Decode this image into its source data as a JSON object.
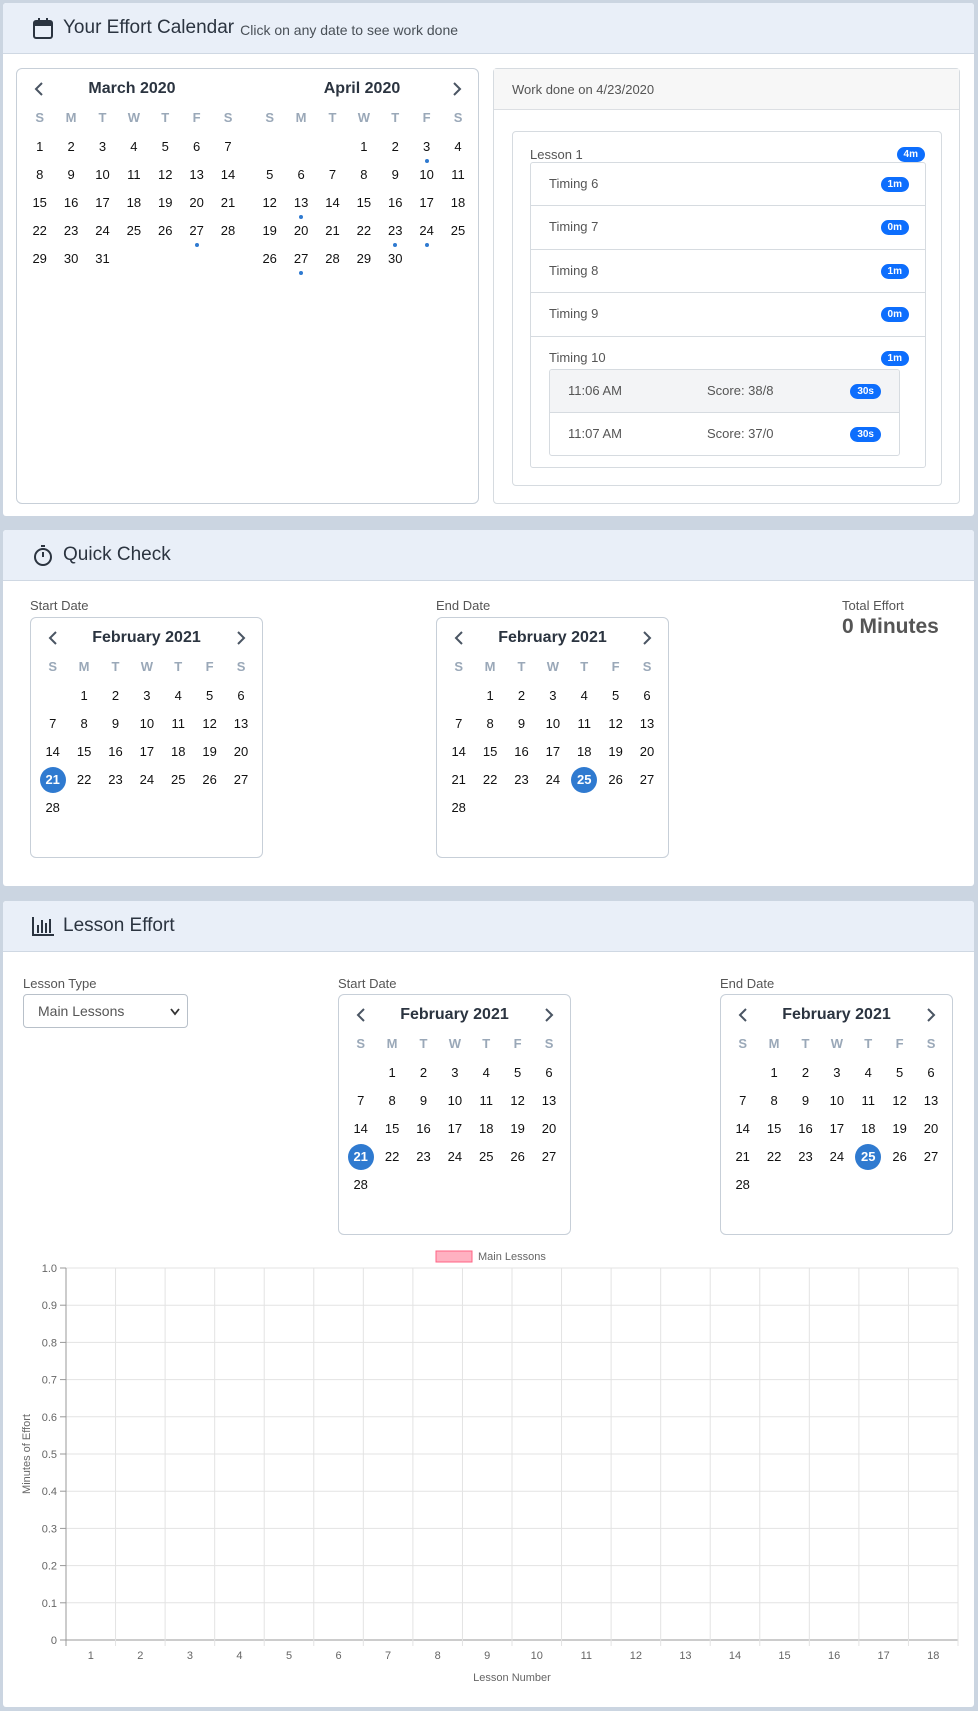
{
  "effort": {
    "title": "Your Effort Calendar",
    "subtitle": "Click on any date to see work done",
    "months": [
      {
        "title": "March 2020",
        "lead": 0,
        "days": 31,
        "dots": [
          27
        ]
      },
      {
        "title": "April 2020",
        "lead": 3,
        "days": 30,
        "dots": [
          3,
          13,
          23,
          24,
          27
        ]
      }
    ],
    "work_header": "Work done on 4/23/2020",
    "lesson": {
      "name": "Lesson 1",
      "badge": "4m"
    },
    "timings": [
      {
        "name": "Timing 6",
        "badge": "1m"
      },
      {
        "name": "Timing 7",
        "badge": "0m"
      },
      {
        "name": "Timing 8",
        "badge": "1m"
      },
      {
        "name": "Timing 9",
        "badge": "0m"
      },
      {
        "name": "Timing 10",
        "badge": "1m"
      }
    ],
    "attempts": [
      {
        "time": "11:06 AM",
        "score": "Score: 38/8",
        "badge": "30s"
      },
      {
        "time": "11:07 AM",
        "score": "Score: 37/0",
        "badge": "30s"
      }
    ]
  },
  "weekday_letters": [
    "S",
    "M",
    "T",
    "W",
    "T",
    "F",
    "S"
  ],
  "quick": {
    "title": "Quick Check",
    "start_label": "Start Date",
    "end_label": "End Date",
    "start_month": {
      "title": "February 2021",
      "lead": 1,
      "days": 28,
      "selected": 21
    },
    "end_month": {
      "title": "February 2021",
      "lead": 1,
      "days": 28,
      "selected": 25
    },
    "total_label": "Total Effort",
    "total_value": "0 Minutes"
  },
  "lesson_effort": {
    "title": "Lesson Effort",
    "type_label": "Lesson Type",
    "type_selected": "Main Lessons",
    "start_label": "Start Date",
    "end_label": "End Date",
    "start_month": {
      "title": "February 2021",
      "lead": 1,
      "days": 28,
      "selected": 21
    },
    "end_month": {
      "title": "February 2021",
      "lead": 1,
      "days": 28,
      "selected": 25
    }
  },
  "chart_data": {
    "type": "bar",
    "legend": "Main Lessons",
    "legend_position": "top",
    "legend_color": "#ffb1c1",
    "xlabel": "Lesson Number",
    "ylabel": "Minutes of Effort",
    "categories": [
      "1",
      "2",
      "3",
      "4",
      "5",
      "6",
      "7",
      "8",
      "9",
      "10",
      "11",
      "12",
      "13",
      "14",
      "15",
      "16",
      "17",
      "18"
    ],
    "yticks": [
      "0",
      "0.1",
      "0.2",
      "0.3",
      "0.4",
      "0.5",
      "0.6",
      "0.7",
      "0.8",
      "0.9",
      "1.0"
    ],
    "ylim": [
      0,
      1
    ],
    "grid": true,
    "series": [
      {
        "name": "Main Lessons",
        "values": [
          0,
          0,
          0,
          0,
          0,
          0,
          0,
          0,
          0,
          0,
          0,
          0,
          0,
          0,
          0,
          0,
          0,
          0
        ]
      }
    ]
  }
}
